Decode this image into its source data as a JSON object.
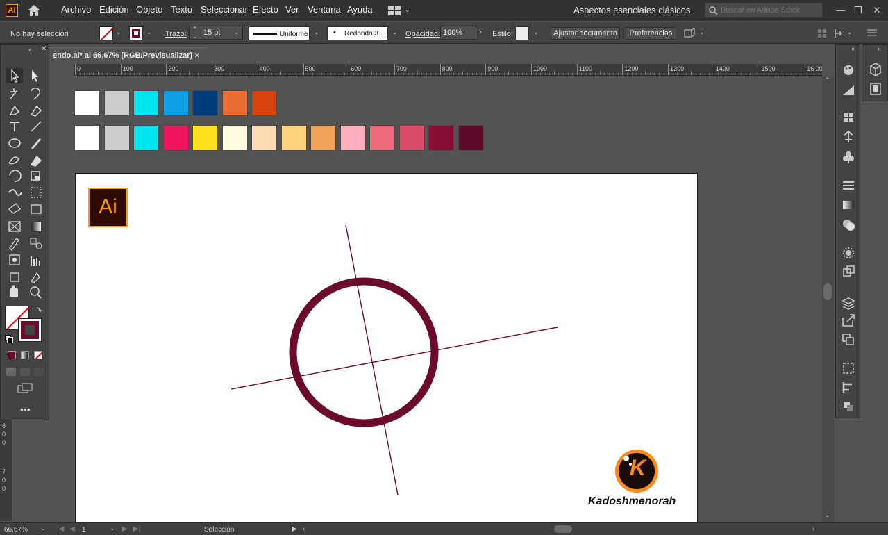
{
  "app": {
    "logo_text": "Ai",
    "menu": [
      "Archivo",
      "Edición",
      "Objeto",
      "Texto",
      "Seleccionar",
      "Efecto",
      "Ver",
      "Ventana",
      "Ayuda"
    ],
    "workspace": "Aspectos esenciales clásicos",
    "stock_search_placeholder": "Buscar en Adobe Stock"
  },
  "controlbar": {
    "selection_status": "No hay selección",
    "stroke_label": "Trazo:",
    "stroke_weight": "15 pt",
    "stroke_profile": "Uniforme",
    "brush": "Redondo 3 ...",
    "opacity_label": "Opacidad:",
    "opacity_value": "100%",
    "style_label": "Estilo:",
    "adjust_doc_button": "Ajustar documento",
    "preferences_button": "Preferencias"
  },
  "document": {
    "tab_title": "endo.ai* al 66,67% (RGB/Previsualizar)",
    "close_glyph": "×"
  },
  "ruler": {
    "ticks": [
      "0",
      "100",
      "200",
      "300",
      "400",
      "500",
      "600",
      "700",
      "800",
      "900",
      "1000",
      "1100",
      "1200",
      "1300",
      "1400",
      "1500",
      "16 00"
    ],
    "left_ticks": [
      "6\n0\n0",
      "7\n0\n0"
    ]
  },
  "swatches": {
    "row1": [
      "#ffffff",
      "#cccccc",
      "#00e5ee",
      "#0ea0e6",
      "#003d78",
      "#ea6e33",
      "#d64510"
    ],
    "row2": [
      "#ffffff",
      "#cccccc",
      "#00e5ee",
      "#f0145e",
      "#ffe21c",
      "#fffbe0",
      "#fddcb2",
      "#fdd27c",
      "#f0a35a",
      "#fcadbf",
      "#ef6b7c",
      "#db4b6a",
      "#870d32",
      "#5e0a2a"
    ]
  },
  "artwork": {
    "logo_text": "Ai",
    "stroke_color": "#6b0a2a",
    "watermark_letter": "K",
    "watermark_name": "Kadoshmenorah"
  },
  "status": {
    "zoom": "66,67%",
    "artboard_number": "1",
    "tool_name": "Selección"
  },
  "colors": {
    "fill_stroke": "#6b0a2a",
    "accent_orange": "#ff9a00"
  }
}
